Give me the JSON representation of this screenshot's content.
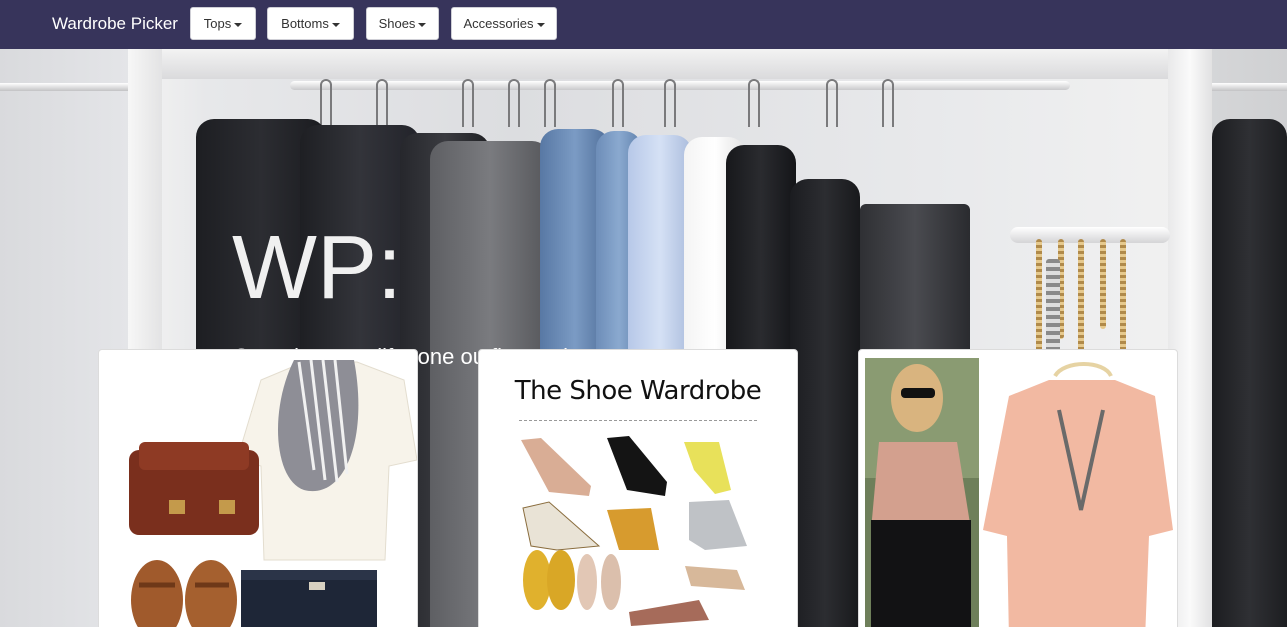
{
  "navbar": {
    "brand": "Wardrobe Picker",
    "menus": [
      {
        "label": "Tops"
      },
      {
        "label": "Bottoms"
      },
      {
        "label": "Shoes"
      },
      {
        "label": "Accessories"
      }
    ]
  },
  "hero": {
    "title": "WP:",
    "subtitle": "Organize your life, one outfit at a time."
  },
  "cards": [
    {
      "title": ""
    },
    {
      "title": "The Shoe Wardrobe"
    },
    {
      "title": ""
    }
  ],
  "colors": {
    "navbar": "#37345b",
    "nav_button_bg": "#ffffff",
    "hero_text": "#ffffff"
  }
}
